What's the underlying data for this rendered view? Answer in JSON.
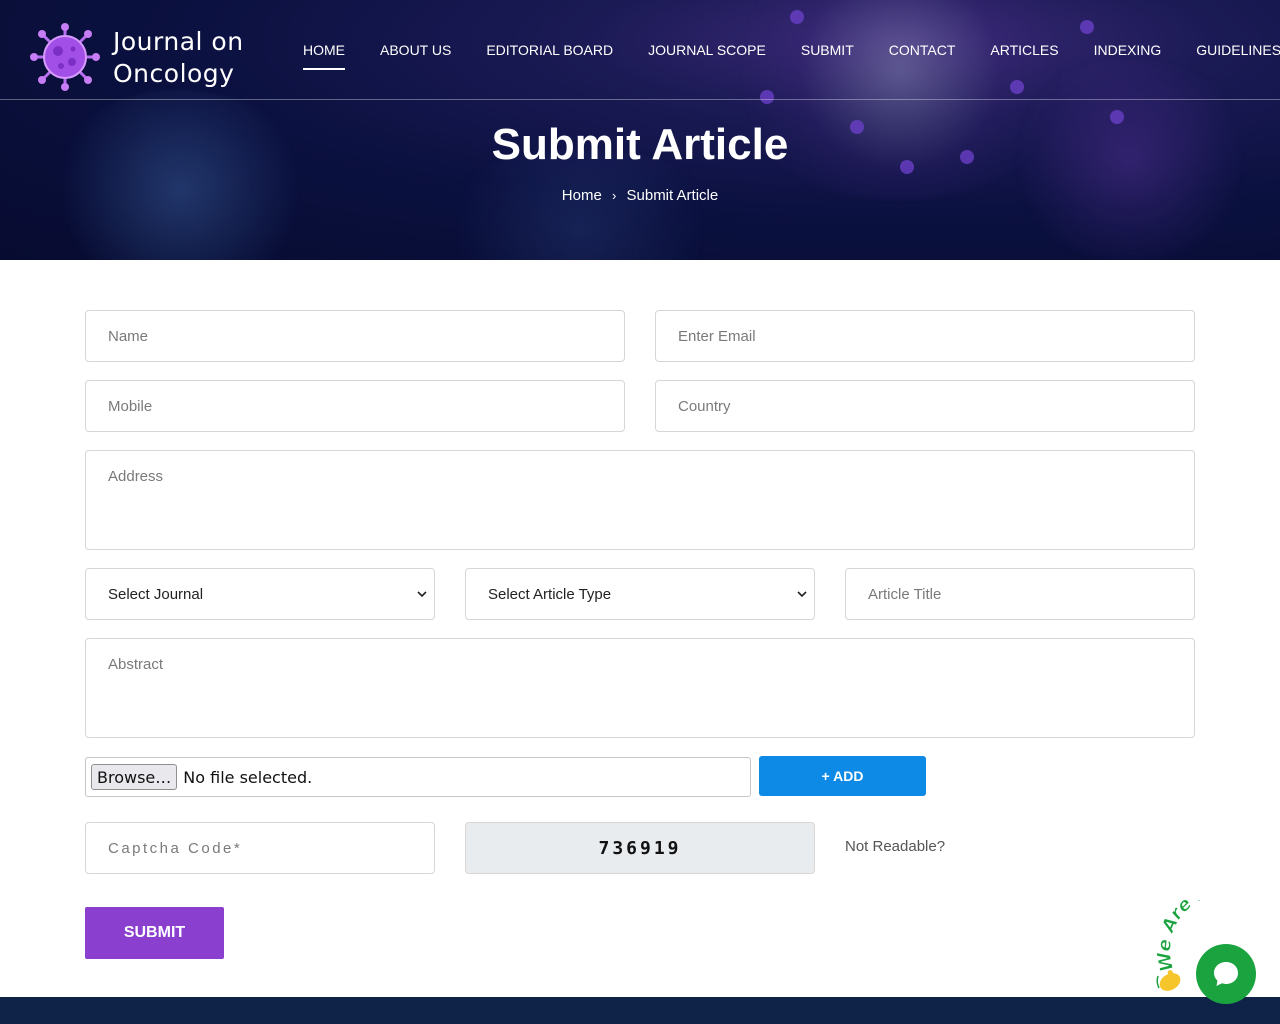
{
  "brand": {
    "line1": "Journal on",
    "line2": "Oncology"
  },
  "nav": {
    "items": [
      {
        "label": "HOME",
        "active": true
      },
      {
        "label": "ABOUT US"
      },
      {
        "label": "EDITORIAL BOARD"
      },
      {
        "label": "JOURNAL SCOPE"
      },
      {
        "label": "SUBMIT"
      },
      {
        "label": "CONTACT"
      },
      {
        "label": "ARTICLES"
      },
      {
        "label": "INDEXING"
      },
      {
        "label": "GUIDELINES"
      }
    ]
  },
  "hero": {
    "title": "Submit Article",
    "breadcrumb": {
      "home": "Home",
      "separator": "›",
      "current": "Submit Article"
    }
  },
  "form": {
    "name_placeholder": "Name",
    "email_placeholder": "Enter Email",
    "mobile_placeholder": "Mobile",
    "country_placeholder": "Country",
    "address_placeholder": "Address",
    "journal_select": "Select Journal",
    "article_type_select": "Select Article Type",
    "article_title_placeholder": "Article Title",
    "abstract_placeholder": "Abstract",
    "file": {
      "browse_label": "Browse…",
      "status": "No file selected."
    },
    "add_label": "+ ADD",
    "captcha_placeholder": "Captcha Code*",
    "captcha_code": "736919",
    "not_readable": "Not Readable?",
    "submit_label": "SUBMIT"
  },
  "chat": {
    "text": "We Are Here!",
    "icon": "chat-bubble-icon",
    "color": "#1aa33e"
  },
  "colors": {
    "accent_purple": "#8a3fcf",
    "add_blue": "#0d8ae6",
    "footer": "#0f2248"
  }
}
